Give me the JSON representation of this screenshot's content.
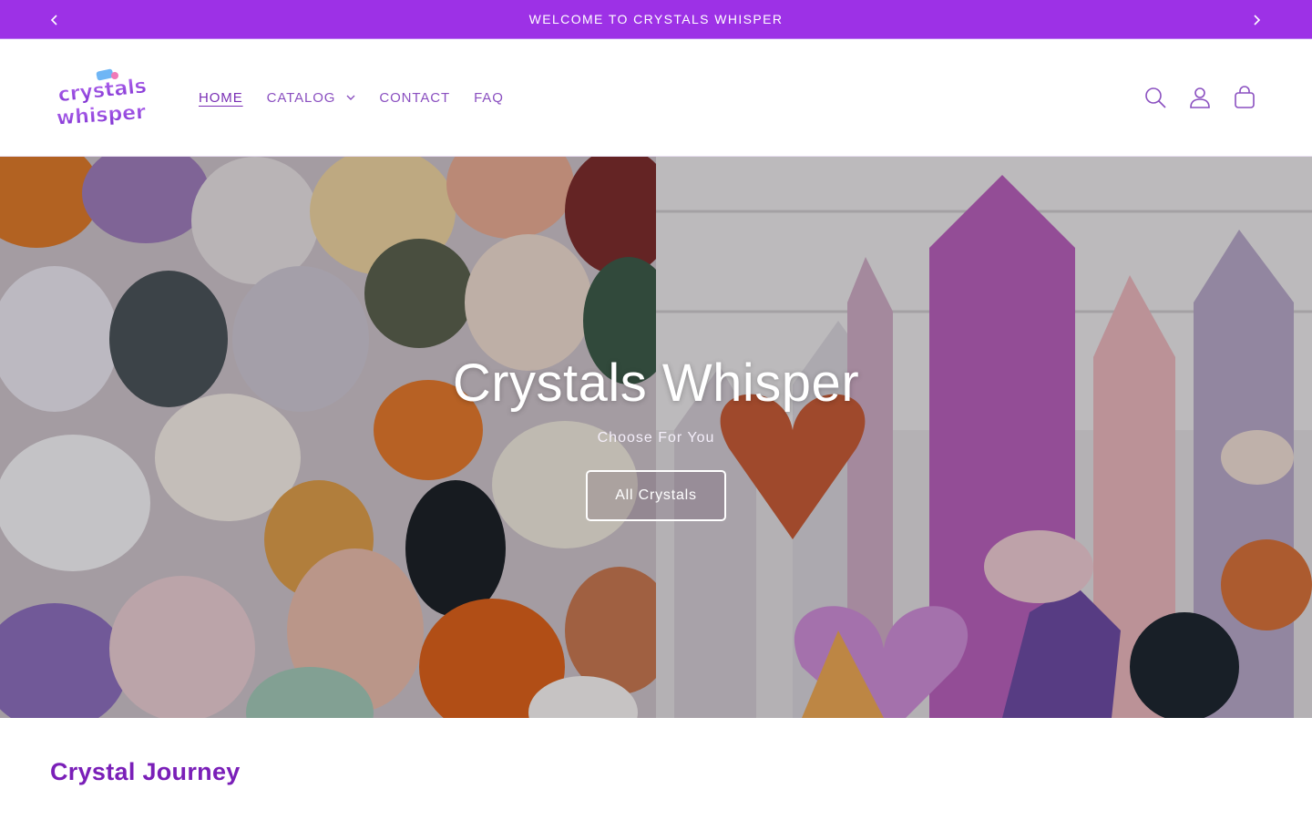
{
  "announcement": {
    "text": "WELCOME TO CRYSTALS WHISPER",
    "prev_icon": "chevron-left-icon",
    "next_icon": "chevron-right-icon",
    "bg_color": "#9d31e6"
  },
  "brand": {
    "logo_line1": "crystals",
    "logo_line2": "whisper"
  },
  "nav": {
    "items": [
      {
        "label": "HOME",
        "active": true
      },
      {
        "label": "CATALOG",
        "has_dropdown": true
      },
      {
        "label": "CONTACT"
      },
      {
        "label": "FAQ"
      }
    ]
  },
  "header_icons": [
    "search-icon",
    "account-icon",
    "cart-icon"
  ],
  "hero": {
    "title": "Crystals Whisper",
    "subtitle": "Choose For You",
    "button_label": "All Crystals"
  },
  "section": {
    "title": "Crystal Journey"
  },
  "colors": {
    "accent": "#9d31e6",
    "nav_text": "#8a4fc0",
    "heading": "#7a1fb8"
  }
}
